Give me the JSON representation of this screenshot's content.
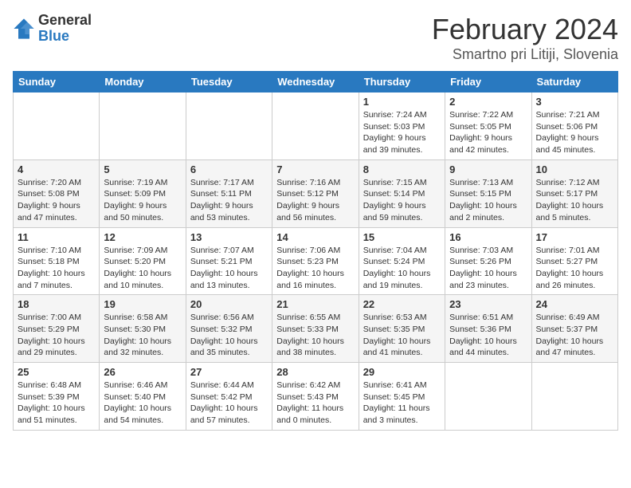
{
  "header": {
    "logo_general": "General",
    "logo_blue": "Blue",
    "month_title": "February 2024",
    "location": "Smartno pri Litiji, Slovenia"
  },
  "weekdays": [
    "Sunday",
    "Monday",
    "Tuesday",
    "Wednesday",
    "Thursday",
    "Friday",
    "Saturday"
  ],
  "weeks": [
    [
      {
        "day": "",
        "info": ""
      },
      {
        "day": "",
        "info": ""
      },
      {
        "day": "",
        "info": ""
      },
      {
        "day": "",
        "info": ""
      },
      {
        "day": "1",
        "info": "Sunrise: 7:24 AM\nSunset: 5:03 PM\nDaylight: 9 hours\nand 39 minutes."
      },
      {
        "day": "2",
        "info": "Sunrise: 7:22 AM\nSunset: 5:05 PM\nDaylight: 9 hours\nand 42 minutes."
      },
      {
        "day": "3",
        "info": "Sunrise: 7:21 AM\nSunset: 5:06 PM\nDaylight: 9 hours\nand 45 minutes."
      }
    ],
    [
      {
        "day": "4",
        "info": "Sunrise: 7:20 AM\nSunset: 5:08 PM\nDaylight: 9 hours\nand 47 minutes."
      },
      {
        "day": "5",
        "info": "Sunrise: 7:19 AM\nSunset: 5:09 PM\nDaylight: 9 hours\nand 50 minutes."
      },
      {
        "day": "6",
        "info": "Sunrise: 7:17 AM\nSunset: 5:11 PM\nDaylight: 9 hours\nand 53 minutes."
      },
      {
        "day": "7",
        "info": "Sunrise: 7:16 AM\nSunset: 5:12 PM\nDaylight: 9 hours\nand 56 minutes."
      },
      {
        "day": "8",
        "info": "Sunrise: 7:15 AM\nSunset: 5:14 PM\nDaylight: 9 hours\nand 59 minutes."
      },
      {
        "day": "9",
        "info": "Sunrise: 7:13 AM\nSunset: 5:15 PM\nDaylight: 10 hours\nand 2 minutes."
      },
      {
        "day": "10",
        "info": "Sunrise: 7:12 AM\nSunset: 5:17 PM\nDaylight: 10 hours\nand 5 minutes."
      }
    ],
    [
      {
        "day": "11",
        "info": "Sunrise: 7:10 AM\nSunset: 5:18 PM\nDaylight: 10 hours\nand 7 minutes."
      },
      {
        "day": "12",
        "info": "Sunrise: 7:09 AM\nSunset: 5:20 PM\nDaylight: 10 hours\nand 10 minutes."
      },
      {
        "day": "13",
        "info": "Sunrise: 7:07 AM\nSunset: 5:21 PM\nDaylight: 10 hours\nand 13 minutes."
      },
      {
        "day": "14",
        "info": "Sunrise: 7:06 AM\nSunset: 5:23 PM\nDaylight: 10 hours\nand 16 minutes."
      },
      {
        "day": "15",
        "info": "Sunrise: 7:04 AM\nSunset: 5:24 PM\nDaylight: 10 hours\nand 19 minutes."
      },
      {
        "day": "16",
        "info": "Sunrise: 7:03 AM\nSunset: 5:26 PM\nDaylight: 10 hours\nand 23 minutes."
      },
      {
        "day": "17",
        "info": "Sunrise: 7:01 AM\nSunset: 5:27 PM\nDaylight: 10 hours\nand 26 minutes."
      }
    ],
    [
      {
        "day": "18",
        "info": "Sunrise: 7:00 AM\nSunset: 5:29 PM\nDaylight: 10 hours\nand 29 minutes."
      },
      {
        "day": "19",
        "info": "Sunrise: 6:58 AM\nSunset: 5:30 PM\nDaylight: 10 hours\nand 32 minutes."
      },
      {
        "day": "20",
        "info": "Sunrise: 6:56 AM\nSunset: 5:32 PM\nDaylight: 10 hours\nand 35 minutes."
      },
      {
        "day": "21",
        "info": "Sunrise: 6:55 AM\nSunset: 5:33 PM\nDaylight: 10 hours\nand 38 minutes."
      },
      {
        "day": "22",
        "info": "Sunrise: 6:53 AM\nSunset: 5:35 PM\nDaylight: 10 hours\nand 41 minutes."
      },
      {
        "day": "23",
        "info": "Sunrise: 6:51 AM\nSunset: 5:36 PM\nDaylight: 10 hours\nand 44 minutes."
      },
      {
        "day": "24",
        "info": "Sunrise: 6:49 AM\nSunset: 5:37 PM\nDaylight: 10 hours\nand 47 minutes."
      }
    ],
    [
      {
        "day": "25",
        "info": "Sunrise: 6:48 AM\nSunset: 5:39 PM\nDaylight: 10 hours\nand 51 minutes."
      },
      {
        "day": "26",
        "info": "Sunrise: 6:46 AM\nSunset: 5:40 PM\nDaylight: 10 hours\nand 54 minutes."
      },
      {
        "day": "27",
        "info": "Sunrise: 6:44 AM\nSunset: 5:42 PM\nDaylight: 10 hours\nand 57 minutes."
      },
      {
        "day": "28",
        "info": "Sunrise: 6:42 AM\nSunset: 5:43 PM\nDaylight: 11 hours\nand 0 minutes."
      },
      {
        "day": "29",
        "info": "Sunrise: 6:41 AM\nSunset: 5:45 PM\nDaylight: 11 hours\nand 3 minutes."
      },
      {
        "day": "",
        "info": ""
      },
      {
        "day": "",
        "info": ""
      }
    ]
  ]
}
